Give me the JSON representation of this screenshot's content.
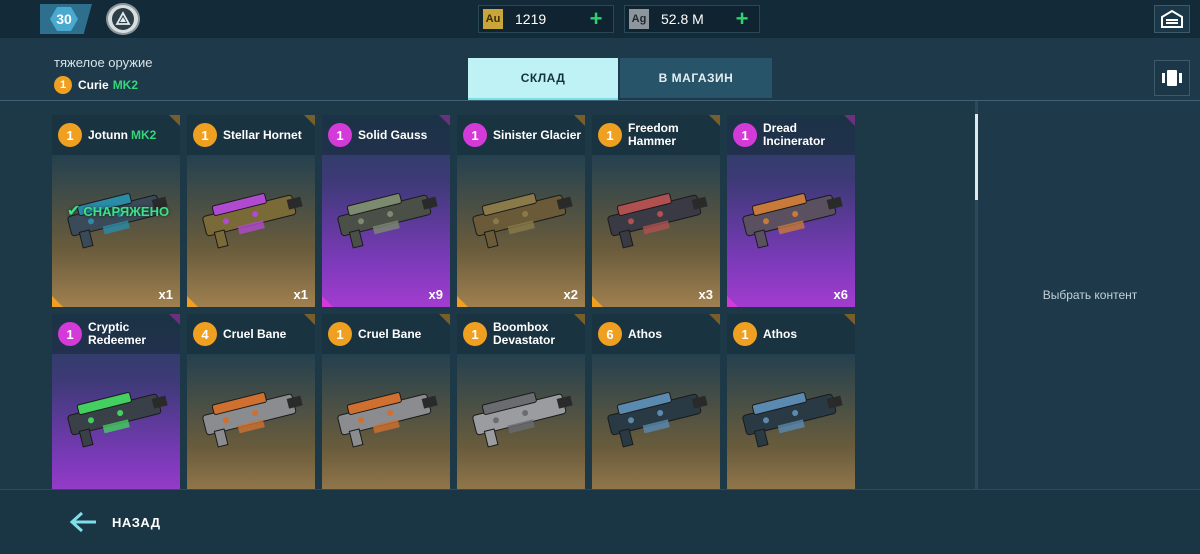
{
  "topbar": {
    "level": "30",
    "gold": {
      "tag": "Au",
      "amount": "1219"
    },
    "silver": {
      "tag": "Ag",
      "amount": "52.8 M"
    }
  },
  "header": {
    "category": "тяжелое оружие",
    "robot": {
      "level": "1",
      "name": "Curie",
      "mk": "MK2"
    },
    "tabs": {
      "storage": "СКЛАД",
      "shop": "В МАГАЗИН"
    }
  },
  "cards": [
    {
      "level": "1",
      "name": "Jotunn",
      "mk": "MK2",
      "count": "x1",
      "rarity": "gold",
      "level_color": "gold",
      "equipped": "СНАРЯЖЕНО"
    },
    {
      "level": "1",
      "name": "Stellar Hornet",
      "mk": "",
      "count": "x1",
      "rarity": "gold",
      "level_color": "gold",
      "equipped": ""
    },
    {
      "level": "1",
      "name": "Solid Gauss",
      "mk": "",
      "count": "x9",
      "rarity": "purple",
      "level_color": "purple",
      "equipped": ""
    },
    {
      "level": "1",
      "name": "Sinister Glacier",
      "mk": "",
      "count": "x2",
      "rarity": "gold",
      "level_color": "purple",
      "equipped": ""
    },
    {
      "level": "1",
      "name": "Freedom Hammer",
      "mk": "",
      "count": "x3",
      "rarity": "gold",
      "level_color": "gold",
      "equipped": ""
    },
    {
      "level": "1",
      "name": "Dread Incinerator",
      "mk": "",
      "count": "x6",
      "rarity": "purple",
      "level_color": "purple",
      "equipped": ""
    },
    {
      "level": "1",
      "name": "Cryptic Redeemer",
      "mk": "",
      "count": "",
      "rarity": "purple",
      "level_color": "purple",
      "equipped": ""
    },
    {
      "level": "4",
      "name": "Cruel Bane",
      "mk": "",
      "count": "",
      "rarity": "gold",
      "level_color": "gold",
      "equipped": ""
    },
    {
      "level": "1",
      "name": "Cruel Bane",
      "mk": "",
      "count": "",
      "rarity": "gold",
      "level_color": "gold",
      "equipped": ""
    },
    {
      "level": "1",
      "name": "Boombox Devastator",
      "mk": "",
      "count": "",
      "rarity": "gold",
      "level_color": "gold",
      "equipped": ""
    },
    {
      "level": "6",
      "name": "Athos",
      "mk": "",
      "count": "",
      "rarity": "gold",
      "level_color": "gold",
      "equipped": ""
    },
    {
      "level": "1",
      "name": "Athos",
      "mk": "",
      "count": "",
      "rarity": "gold",
      "level_color": "gold",
      "equipped": ""
    }
  ],
  "right_panel": {
    "placeholder": "Выбрать контент"
  },
  "footer": {
    "back_label": "НАЗАД"
  },
  "colors": {
    "gold": "#f0a020",
    "purple": "#d43ad8",
    "accent_green": "#34d67a",
    "tab_active": "#bff2f4"
  },
  "icons": {
    "garage": "garage-icon",
    "filter": "filter-icon",
    "back": "arrow-left-icon",
    "equipped": "checkmark-icon"
  }
}
